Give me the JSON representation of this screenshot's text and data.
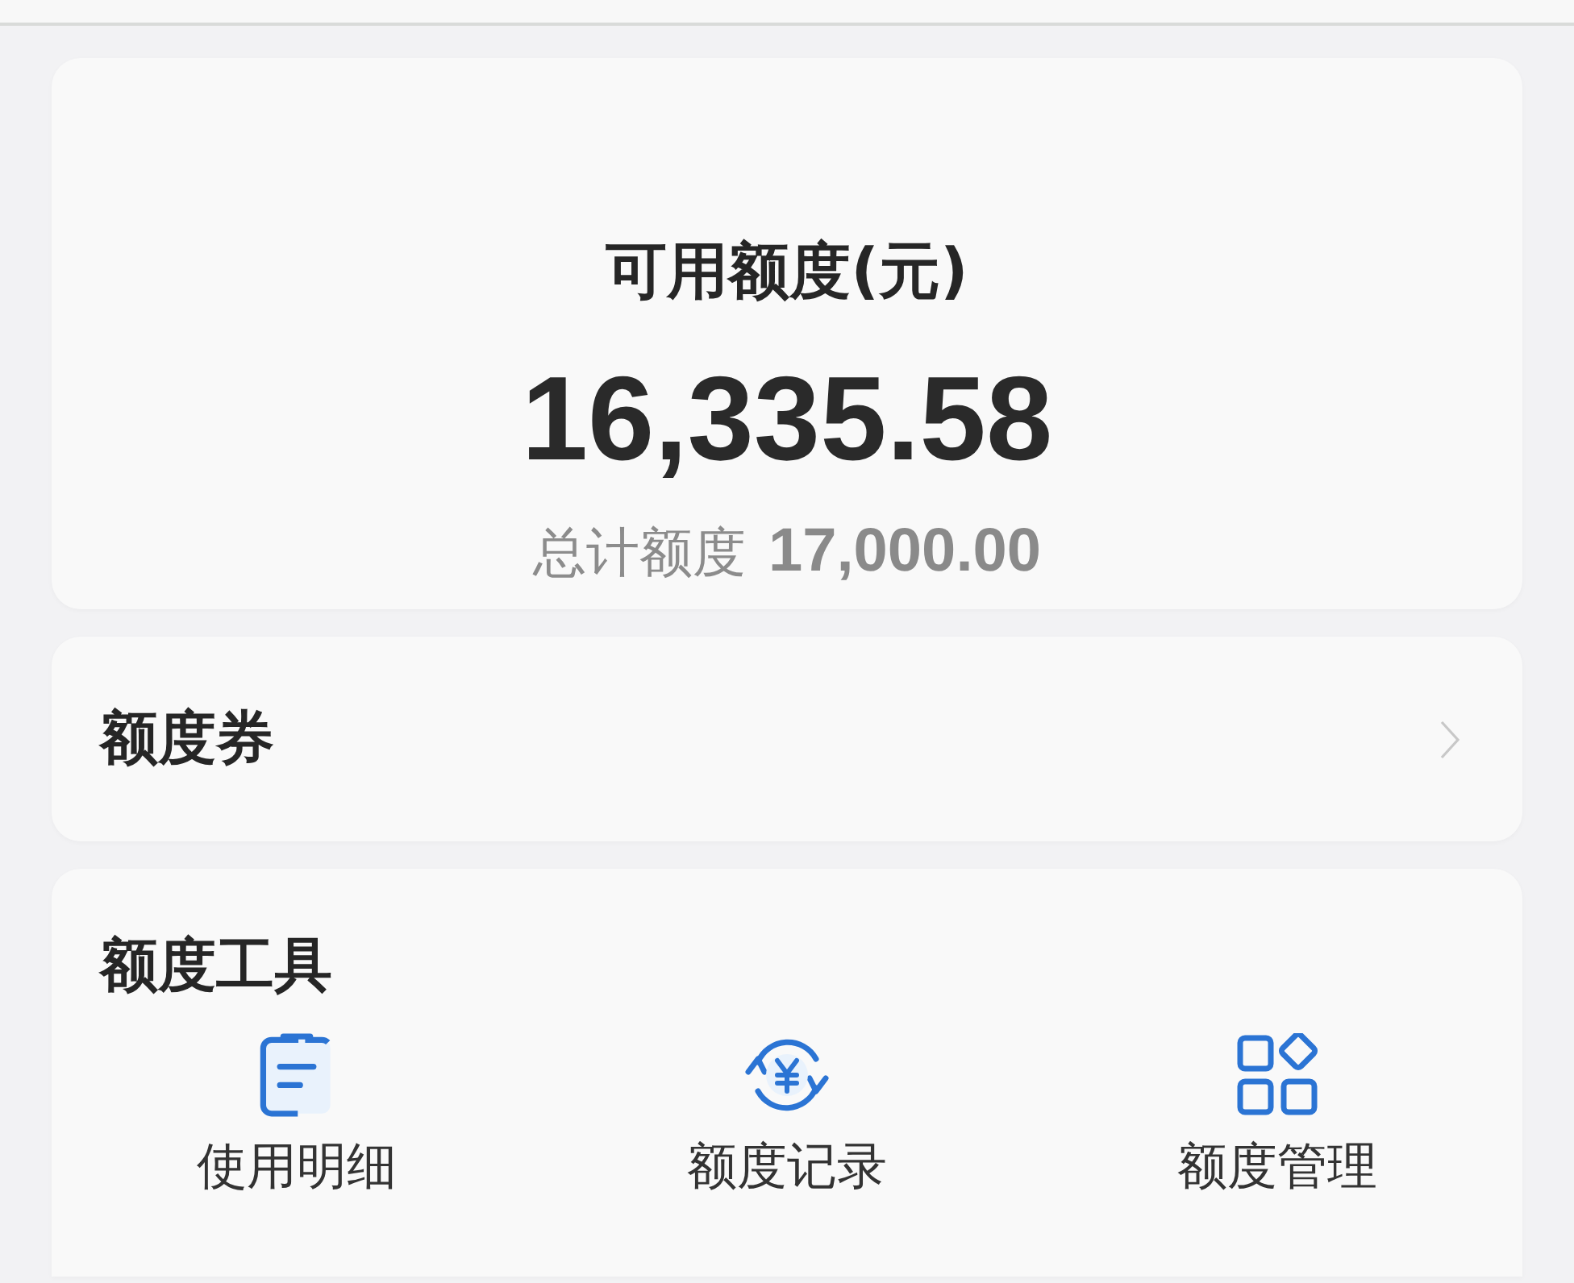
{
  "balance_card": {
    "title": "可用额度(元)",
    "amount": "16,335.58",
    "total_label": "总计额度",
    "total_amount": "17,000.00"
  },
  "coupon_row": {
    "label": "额度券"
  },
  "tools": {
    "title": "额度工具",
    "items": [
      {
        "kind": "detail",
        "label": "使用明细"
      },
      {
        "kind": "record",
        "label": "额度记录"
      },
      {
        "kind": "manage",
        "label": "额度管理"
      }
    ]
  }
}
